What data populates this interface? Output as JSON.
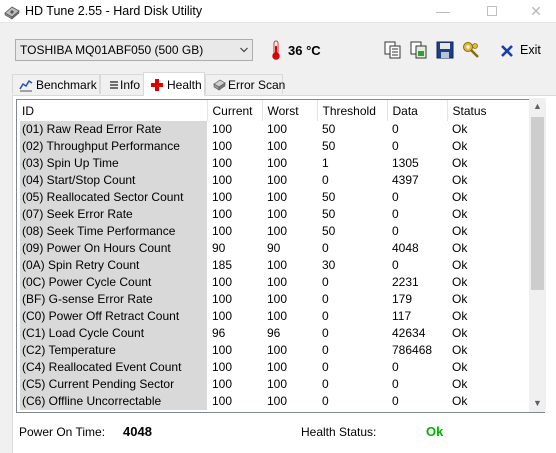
{
  "window": {
    "title": "HD Tune 2.55 - Hard Disk Utility",
    "minimize": "—",
    "close": "✕"
  },
  "toolbar": {
    "drive": "TOSHIBA MQ01ABF050 (500 GB)",
    "temperature": "36 °C",
    "exit_label": "Exit"
  },
  "tabs": [
    {
      "label": "Benchmark",
      "icon": "benchmark-icon"
    },
    {
      "label": "Info",
      "icon": "info-icon"
    },
    {
      "label": "Health",
      "icon": "health-cross-icon",
      "active": true
    },
    {
      "label": "Error Scan",
      "icon": "error-scan-icon"
    }
  ],
  "grid": {
    "columns": [
      "ID",
      "Current",
      "Worst",
      "Threshold",
      "Data",
      "Status"
    ],
    "rows": [
      [
        "(01) Raw Read Error Rate",
        "100",
        "100",
        "50",
        "0",
        "Ok"
      ],
      [
        "(02) Throughput Performance",
        "100",
        "100",
        "50",
        "0",
        "Ok"
      ],
      [
        "(03) Spin Up Time",
        "100",
        "100",
        "1",
        "1305",
        "Ok"
      ],
      [
        "(04) Start/Stop Count",
        "100",
        "100",
        "0",
        "4397",
        "Ok"
      ],
      [
        "(05) Reallocated Sector Count",
        "100",
        "100",
        "50",
        "0",
        "Ok"
      ],
      [
        "(07) Seek Error Rate",
        "100",
        "100",
        "50",
        "0",
        "Ok"
      ],
      [
        "(08) Seek Time Performance",
        "100",
        "100",
        "50",
        "0",
        "Ok"
      ],
      [
        "(09) Power On Hours Count",
        "90",
        "90",
        "0",
        "4048",
        "Ok"
      ],
      [
        "(0A) Spin Retry Count",
        "185",
        "100",
        "30",
        "0",
        "Ok"
      ],
      [
        "(0C) Power Cycle Count",
        "100",
        "100",
        "0",
        "2231",
        "Ok"
      ],
      [
        "(BF) G-sense Error Rate",
        "100",
        "100",
        "0",
        "179",
        "Ok"
      ],
      [
        "(C0) Power Off Retract Count",
        "100",
        "100",
        "0",
        "117",
        "Ok"
      ],
      [
        "(C1) Load Cycle Count",
        "96",
        "96",
        "0",
        "42634",
        "Ok"
      ],
      [
        "(C2) Temperature",
        "100",
        "100",
        "0",
        "786468",
        "Ok"
      ],
      [
        "(C4) Reallocated Event Count",
        "100",
        "100",
        "0",
        "0",
        "Ok"
      ],
      [
        "(C5) Current Pending Sector",
        "100",
        "100",
        "0",
        "0",
        "Ok"
      ],
      [
        "(C6) Offline Uncorrectable",
        "100",
        "100",
        "0",
        "0",
        "Ok"
      ]
    ]
  },
  "status": {
    "power_on_label": "Power On Time:",
    "power_on_value": "4048",
    "health_label": "Health Status:",
    "health_value": "Ok"
  },
  "colors": {
    "health_ok": "#00b400",
    "id_cell_bg": "#d9d9d9",
    "health_tab_cross": "#e00000"
  }
}
